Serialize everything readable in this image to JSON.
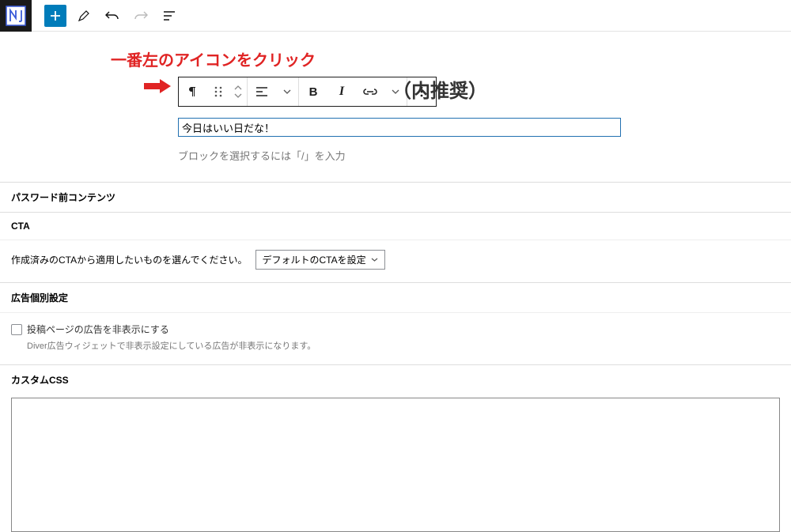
{
  "annotation": "一番左のアイコンをクリック",
  "title_behind": "（内推奨）",
  "paragraph_value": "今日はいい日だな！",
  "placeholder_row": "ブロックを選択するには「/」を入力",
  "metabox1": {
    "title": "パスワード前コンテンツ"
  },
  "metabox2": {
    "title": "CTA",
    "desc": "作成済みのCTAから適用したいものを選んでください。",
    "select_label": "デフォルトのCTAを設定"
  },
  "metabox3": {
    "title": "広告個別設定",
    "checkbox_label": "投稿ページの広告を非表示にする",
    "desc": "Diver広告ウィジェットで非表示設定にしている広告が非表示になります。"
  },
  "metabox4": {
    "title": "カスタムCSS"
  },
  "toolbar": {
    "bold": "B",
    "italic": "I"
  }
}
